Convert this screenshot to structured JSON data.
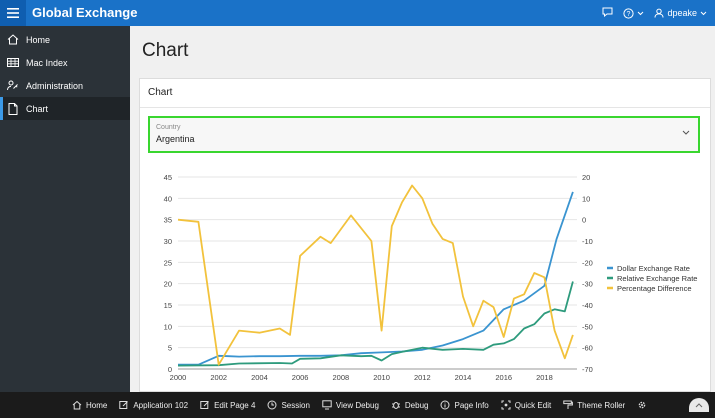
{
  "app": {
    "title": "Global Exchange"
  },
  "header": {
    "user": "dpeake"
  },
  "sidebar": {
    "items": [
      {
        "label": "Home",
        "icon": "home-icon"
      },
      {
        "label": "Mac Index",
        "icon": "table-icon"
      },
      {
        "label": "Administration",
        "icon": "user-key-icon"
      },
      {
        "label": "Chart",
        "icon": "file-icon",
        "active": true
      }
    ]
  },
  "page": {
    "title": "Chart"
  },
  "card": {
    "title": "Chart"
  },
  "country_select": {
    "label": "Country",
    "value": "Argentina"
  },
  "chart_data": {
    "type": "line",
    "x": [
      2000,
      2001,
      2002,
      2003,
      2004,
      2005,
      2006,
      2007,
      2008,
      2009,
      2010,
      2011,
      2012,
      2013,
      2014,
      2015,
      2016,
      2017,
      2018,
      2019
    ],
    "x_ticks": [
      2000,
      2002,
      2004,
      2006,
      2008,
      2010,
      2012,
      2014,
      2016,
      2018
    ],
    "xlim": [
      2000,
      2019.6
    ],
    "ylim_left": [
      0,
      45
    ],
    "yticks_left": [
      0,
      5,
      10,
      15,
      20,
      25,
      30,
      35,
      40,
      45
    ],
    "ylim_right": [
      -70,
      20
    ],
    "yticks_right": [
      20,
      10,
      0,
      -10,
      -20,
      -30,
      -40,
      -50,
      -60,
      -70
    ],
    "legend_position": "right",
    "series": [
      {
        "name": "Dollar Exchange Rate",
        "axis": "left",
        "color": "#3a94d0",
        "points": [
          [
            2000,
            1.0
          ],
          [
            2001,
            1.0
          ],
          [
            2002,
            3.1
          ],
          [
            2002.5,
            3.0
          ],
          [
            2003,
            2.9
          ],
          [
            2004,
            3.0
          ],
          [
            2005,
            3.0
          ],
          [
            2006,
            3.1
          ],
          [
            2007,
            3.1
          ],
          [
            2008,
            3.2
          ],
          [
            2009,
            3.7
          ],
          [
            2010,
            3.9
          ],
          [
            2011,
            4.1
          ],
          [
            2012,
            4.5
          ],
          [
            2013,
            5.5
          ],
          [
            2014,
            7.0
          ],
          [
            2015,
            9.0
          ],
          [
            2016,
            14.0
          ],
          [
            2017,
            16.0
          ],
          [
            2018,
            19.5
          ],
          [
            2018.6,
            30.5
          ],
          [
            2019.4,
            41.5
          ]
        ]
      },
      {
        "name": "Relative Exchange Rate",
        "axis": "left",
        "color": "#2e9b7d",
        "points": [
          [
            2000,
            0.8
          ],
          [
            2002,
            0.9
          ],
          [
            2003,
            1.3
          ],
          [
            2005,
            1.4
          ],
          [
            2005.6,
            1.3
          ],
          [
            2006,
            2.4
          ],
          [
            2007,
            2.5
          ],
          [
            2008,
            3.2
          ],
          [
            2009,
            3.0
          ],
          [
            2009.5,
            3.1
          ],
          [
            2010,
            2.0
          ],
          [
            2010.5,
            3.5
          ],
          [
            2011,
            4.0
          ],
          [
            2012,
            5.0
          ],
          [
            2013,
            4.5
          ],
          [
            2014,
            4.7
          ],
          [
            2015,
            4.5
          ],
          [
            2015.5,
            5.7
          ],
          [
            2016,
            6.0
          ],
          [
            2016.5,
            7.0
          ],
          [
            2017,
            9.5
          ],
          [
            2017.5,
            10.5
          ],
          [
            2018,
            13.0
          ],
          [
            2018.5,
            14.0
          ],
          [
            2019,
            13.5
          ],
          [
            2019.4,
            20.5
          ]
        ]
      },
      {
        "name": "Percentage Difference",
        "axis": "right",
        "color": "#f2c23c",
        "points": [
          [
            2000,
            0
          ],
          [
            2001,
            -1
          ],
          [
            2002,
            -68
          ],
          [
            2003,
            -52
          ],
          [
            2004,
            -53
          ],
          [
            2005,
            -51
          ],
          [
            2005.5,
            -54
          ],
          [
            2006,
            -17
          ],
          [
            2007,
            -8
          ],
          [
            2007.5,
            -11
          ],
          [
            2008.5,
            2
          ],
          [
            2009.5,
            -10
          ],
          [
            2010,
            -52
          ],
          [
            2010.5,
            -3
          ],
          [
            2011,
            8
          ],
          [
            2011.5,
            16
          ],
          [
            2012,
            10
          ],
          [
            2012.5,
            -2
          ],
          [
            2013,
            -9
          ],
          [
            2013.5,
            -11
          ],
          [
            2014,
            -36
          ],
          [
            2014.5,
            -50
          ],
          [
            2015,
            -38
          ],
          [
            2015.5,
            -41
          ],
          [
            2016,
            -55
          ],
          [
            2016.5,
            -37
          ],
          [
            2017,
            -35
          ],
          [
            2017.5,
            -25
          ],
          [
            2018,
            -27
          ],
          [
            2018.5,
            -52
          ],
          [
            2019,
            -65
          ],
          [
            2019.4,
            -54
          ]
        ]
      }
    ]
  },
  "devbar": {
    "items": [
      {
        "label": "Home",
        "icon": "home-icon"
      },
      {
        "label": "Application 102",
        "icon": "edit-icon"
      },
      {
        "label": "Edit Page 4",
        "icon": "edit-icon"
      },
      {
        "label": "Session",
        "icon": "clock-icon"
      },
      {
        "label": "View Debug",
        "icon": "debug-view-icon"
      },
      {
        "label": "Debug",
        "icon": "bug-icon"
      },
      {
        "label": "Page Info",
        "icon": "info-icon"
      },
      {
        "label": "Quick Edit",
        "icon": "quick-edit-icon"
      },
      {
        "label": "Theme Roller",
        "icon": "paint-roller-icon"
      }
    ]
  }
}
